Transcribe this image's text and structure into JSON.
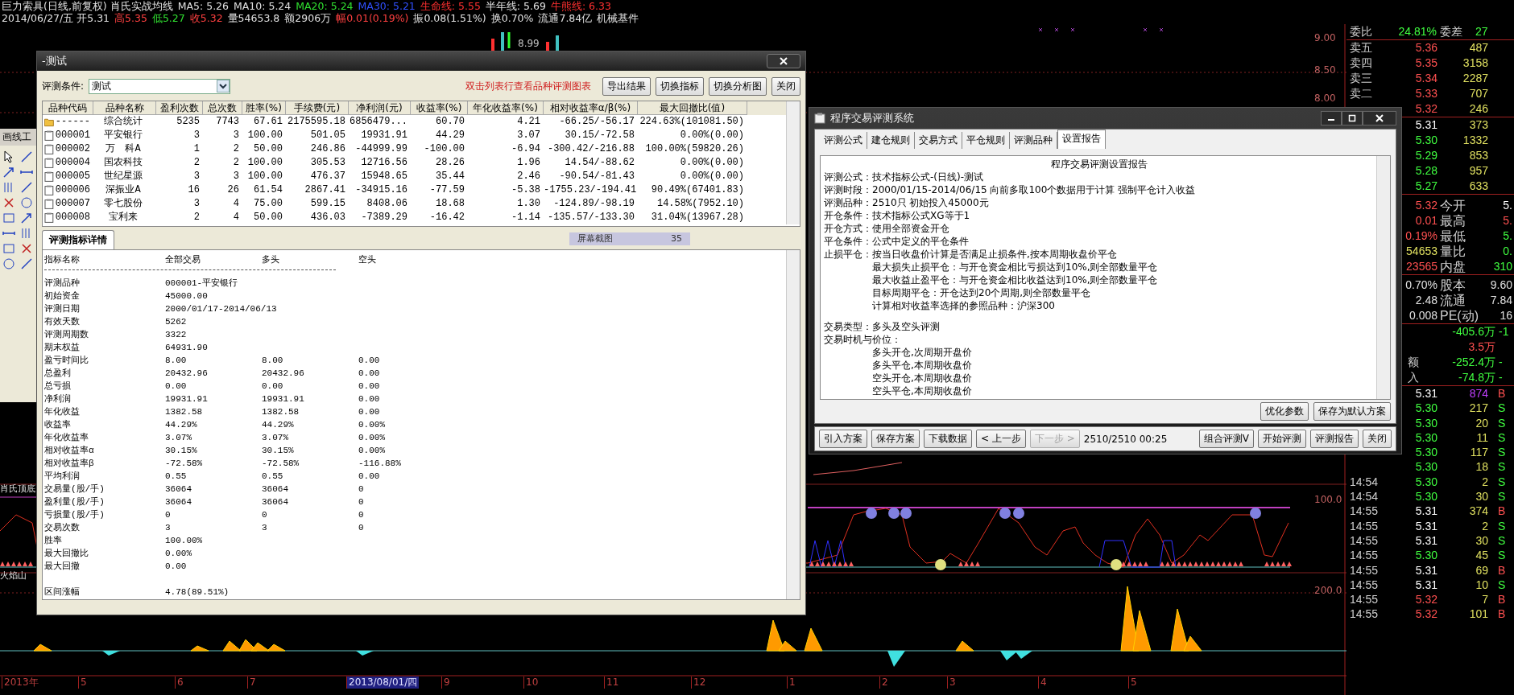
{
  "chart_header": {
    "lines": [
      [
        {
          "text": "巨力索具(日线,前复权) 肖氏实战均线",
          "color": "#e0e0e0"
        },
        {
          "text": "MA5: 5.26",
          "color": "#e0e0e0"
        },
        {
          "text": "MA10: 5.24",
          "color": "#e0e0e0"
        },
        {
          "text": "MA20: 5.24",
          "color": "#30e030"
        },
        {
          "text": "MA30: 5.21",
          "color": "#3050ff"
        },
        {
          "text": "生命线: 5.55",
          "color": "#ff3030"
        },
        {
          "text": "半年线: 5.69",
          "color": "#e0e0e0"
        },
        {
          "text": "牛熊线: 6.33",
          "color": "#ff3030"
        }
      ],
      [
        {
          "text": "2014/06/27/五 开5.31",
          "color": "#e0e0e0"
        },
        {
          "text": "高5.35",
          "color": "#ff4040"
        },
        {
          "text": "低5.27",
          "color": "#30e030"
        },
        {
          "text": "收5.32",
          "color": "#ff4040"
        },
        {
          "text": "量54653.8",
          "color": "#e0e0e0"
        },
        {
          "text": "额2906万",
          "color": "#e0e0e0"
        },
        {
          "text": "幅0.01(0.19%)",
          "color": "#ff4040"
        },
        {
          "text": "振0.08(1.51%)",
          "color": "#e0e0e0"
        },
        {
          "text": "换0.70%",
          "color": "#e0e0e0"
        },
        {
          "text": "流通7.84亿",
          "color": "#e0e0e0"
        },
        {
          "text": "机械基件",
          "color": "#e0e0e0"
        }
      ]
    ]
  },
  "chart": {
    "price_mark": "8.99",
    "price_axis": [
      "9.00",
      "8.50",
      "8.00"
    ],
    "indicator_axis": [
      "100.0",
      "200.0"
    ],
    "indicator_names": [
      "肖氏顶底",
      "火焰山"
    ],
    "time_axis": [
      {
        "label": "2013年",
        "selected": false
      },
      {
        "label": "5",
        "selected": false
      },
      {
        "label": "6",
        "selected": false
      },
      {
        "label": "7",
        "selected": false
      },
      {
        "label": "2013/08/01/四",
        "selected": true
      },
      {
        "label": "9",
        "selected": false
      },
      {
        "label": "10",
        "selected": false
      },
      {
        "label": "11",
        "selected": false
      },
      {
        "label": "12",
        "selected": false
      },
      {
        "label": "1",
        "selected": false
      },
      {
        "label": "2",
        "selected": false
      },
      {
        "label": "3",
        "selected": false
      },
      {
        "label": "4",
        "selected": false
      },
      {
        "label": "5",
        "selected": false
      }
    ]
  },
  "drawing_toolbar": {
    "title": "画线工"
  },
  "quote_panel": {
    "ratio": {
      "label": "委比",
      "value": "24.81%",
      "label2": "委差",
      "value2": "27"
    },
    "asks": [
      {
        "label": "卖五",
        "price": "5.36",
        "volume": "487",
        "color": "#ff5050"
      },
      {
        "label": "卖四",
        "price": "5.35",
        "volume": "3158",
        "color": "#ff5050"
      },
      {
        "label": "卖三",
        "price": "5.34",
        "volume": "2287",
        "color": "#ff5050"
      },
      {
        "label": "卖二",
        "price": "5.33",
        "volume": "707",
        "color": "#ff5050"
      },
      {
        "price": "5.32",
        "volume": "246",
        "color": "#ff5050"
      }
    ],
    "bids": [
      {
        "price": "5.31",
        "volume": "373",
        "color": "#ffffff"
      },
      {
        "price": "5.30",
        "volume": "1332",
        "color": "#40ff40"
      },
      {
        "price": "5.29",
        "volume": "853",
        "color": "#40ff40"
      },
      {
        "price": "5.28",
        "volume": "957",
        "color": "#40ff40"
      },
      {
        "price": "5.27",
        "volume": "633",
        "color": "#40ff40"
      }
    ],
    "stats": [
      {
        "figure": "5.32",
        "label": "今开",
        "right": {
          "text": "5.",
          "color": "#ffffff"
        },
        "color": "#ff5050"
      },
      {
        "figure": "0.01",
        "label": "最高",
        "right": {
          "text": "5.",
          "color": "#ff5050"
        },
        "color": "#ff5050"
      },
      {
        "figure": "0.19%",
        "label": "最低",
        "right": {
          "text": "5.",
          "color": "#40ff40"
        },
        "color": "#ff5050"
      },
      {
        "figure": "54653",
        "label": "量比",
        "right": {
          "text": "0.",
          "color": "#40ff40"
        },
        "color": "#e0e060"
      },
      {
        "figure": "23565",
        "label": "内盘",
        "right": {
          "text": "310",
          "color": "#40ff40"
        },
        "color": "#ff5050"
      },
      {
        "figure": "0.70%",
        "label": "股本",
        "right": {
          "text": "9.60",
          "color": "#e0e0e0"
        },
        "color": "#e0e0e0"
      },
      {
        "figure": "2.48",
        "label": "流通",
        "right": {
          "text": "7.84",
          "color": "#e0e0e0"
        },
        "color": "#e0e0e0"
      },
      {
        "figure": "0.008",
        "label": "PE(动)",
        "right": {
          "text": "16",
          "color": "#e0e0e0"
        },
        "color": "#e0e0e0"
      }
    ],
    "flows": [
      {
        "value": "-405.6万",
        "value2": "-1",
        "color": "#40ff40"
      },
      {
        "value": "3.5万",
        "color": "#ff5050"
      },
      {
        "label": "额",
        "value": "-252.4万",
        "value2": "-",
        "color": "#40ff40"
      },
      {
        "label": "入",
        "value": "-74.8万",
        "value2": "-",
        "color": "#40ff40"
      }
    ],
    "ticks": [
      {
        "price": "5.31",
        "volume": "874",
        "side": "B",
        "color": "#ffffff",
        "large": true
      },
      {
        "price": "5.30",
        "volume": "217",
        "side": "S",
        "color": "#40ff40",
        "large": false
      },
      {
        "price": "5.30",
        "volume": "20",
        "side": "S",
        "color": "#40ff40",
        "large": false
      },
      {
        "price": "5.30",
        "volume": "11",
        "side": "S",
        "color": "#40ff40",
        "large": false
      },
      {
        "price": "5.30",
        "volume": "117",
        "side": "S",
        "color": "#40ff40",
        "large": false
      },
      {
        "price": "5.30",
        "volume": "18",
        "side": "S",
        "color": "#40ff40",
        "large": false
      },
      {
        "time": "14:54",
        "price": "5.30",
        "volume": "2",
        "side": "S",
        "color": "#40ff40",
        "large": false
      },
      {
        "time": "14:54",
        "price": "5.30",
        "volume": "30",
        "side": "S",
        "color": "#40ff40",
        "large": false
      },
      {
        "time": "14:55",
        "price": "5.31",
        "volume": "374",
        "side": "B",
        "color": "#ffffff",
        "large": false
      },
      {
        "time": "14:55",
        "price": "5.31",
        "volume": "2",
        "side": "S",
        "color": "#ffffff",
        "large": false
      },
      {
        "time": "14:55",
        "price": "5.31",
        "volume": "30",
        "side": "S",
        "color": "#ffffff",
        "large": false
      },
      {
        "time": "14:55",
        "price": "5.30",
        "volume": "45",
        "side": "S",
        "color": "#40ff40",
        "large": false
      },
      {
        "time": "14:55",
        "price": "5.31",
        "volume": "69",
        "side": "B",
        "color": "#ffffff",
        "large": false
      },
      {
        "time": "14:55",
        "price": "5.31",
        "volume": "10",
        "side": "S",
        "color": "#ffffff",
        "large": false
      },
      {
        "time": "14:55",
        "price": "5.32",
        "volume": "7",
        "side": "B",
        "color": "#ff5050",
        "large": false
      },
      {
        "time": "14:55",
        "price": "5.32",
        "volume": "101",
        "side": "B",
        "color": "#ff5050",
        "large": false
      }
    ]
  },
  "test_dialog": {
    "title": "-测试",
    "condition_label": "评测条件:",
    "condition_value": "测试",
    "hint": "双击列表行查看品种评测图表",
    "buttons": [
      "导出结果",
      "切换指标",
      "切换分析图",
      "关闭"
    ],
    "columns": [
      "品种代码",
      "品种名称",
      "盈利次数",
      "总次数",
      "胜率(%)",
      "手续费(元)",
      "净利润(元)",
      "收益率(%)",
      "年化收益率(%)",
      "相对收益率α/β(%)",
      "最大回撤比(值)"
    ],
    "rows": [
      {
        "kind": "summary",
        "cells": [
          "------",
          "综合统计",
          "5235",
          "7743",
          "67.61",
          "2175595.18",
          "6856479...",
          "60.70",
          "4.21",
          "-66.25/-56.17",
          "224.63%(101081.50)"
        ]
      },
      {
        "kind": "stock",
        "cells": [
          "000001",
          "平安银行",
          "3",
          "3",
          "100.00",
          "501.05",
          "19931.91",
          "44.29",
          "3.07",
          "30.15/-72.58",
          "0.00%(0.00)"
        ]
      },
      {
        "kind": "stock",
        "cells": [
          "000002",
          "万　科A",
          "1",
          "2",
          "50.00",
          "246.86",
          "-44999.99",
          "-100.00",
          "-6.94",
          "-300.42/-216.88",
          "100.00%(59820.26)"
        ]
      },
      {
        "kind": "stock",
        "cells": [
          "000004",
          "国农科技",
          "2",
          "2",
          "100.00",
          "305.53",
          "12716.56",
          "28.26",
          "1.96",
          "14.54/-88.62",
          "0.00%(0.00)"
        ]
      },
      {
        "kind": "stock",
        "cells": [
          "000005",
          "世纪星源",
          "3",
          "3",
          "100.00",
          "476.37",
          "15948.65",
          "35.44",
          "2.46",
          "-90.54/-81.43",
          "0.00%(0.00)"
        ]
      },
      {
        "kind": "stock",
        "cells": [
          "000006",
          "深振业A",
          "16",
          "26",
          "61.54",
          "2867.41",
          "-34915.16",
          "-77.59",
          "-5.38",
          "-1755.23/-194.41",
          "90.49%(67401.83)"
        ]
      },
      {
        "kind": "stock",
        "cells": [
          "000007",
          "零七股份",
          "3",
          "4",
          "75.00",
          "599.15",
          "8408.06",
          "18.68",
          "1.30",
          "-124.89/-98.19",
          "14.58%(7952.10)"
        ]
      },
      {
        "kind": "stock",
        "cells": [
          "000008",
          "宝利来",
          "2",
          "4",
          "50.00",
          "436.03",
          "-7389.29",
          "-16.42",
          "-1.14",
          "-135.57/-133.30",
          "31.04%(13967.28)"
        ]
      }
    ],
    "popup": {
      "label": "屏幕截图",
      "count": "35"
    },
    "detail_tab": {
      "label": "评测指标详情",
      "selected": true
    },
    "detail_columns": [
      "指标名称",
      "全部交易",
      "多头",
      "空头"
    ],
    "detail_sections": [
      [
        {
          "cells": [
            "评测品种",
            "000001-平安银行"
          ]
        },
        {
          "cells": [
            "初始资金",
            "45000.00"
          ]
        },
        {
          "cells": [
            "评测日期",
            "2000/01/17-2014/06/13"
          ]
        },
        {
          "cells": [
            "有效天数",
            "5262"
          ]
        },
        {
          "cells": [
            "评测周期数",
            "3322"
          ]
        },
        {
          "cells": [
            "期末权益",
            "64931.90"
          ]
        },
        {
          "cells": [
            "盈亏时间比",
            "8.00",
            "8.00",
            "0.00"
          ]
        },
        {
          "cells": [
            "总盈利",
            "20432.96",
            "20432.96",
            "0.00"
          ]
        },
        {
          "cells": [
            "总亏损",
            "0.00",
            "0.00",
            "0.00"
          ]
        },
        {
          "cells": [
            "净利润",
            "19931.91",
            "19931.91",
            "0.00"
          ]
        },
        {
          "cells": [
            "年化收益",
            "1382.58",
            "1382.58",
            "0.00"
          ]
        },
        {
          "cells": [
            "收益率",
            "44.29%",
            "44.29%",
            "0.00%"
          ]
        },
        {
          "cells": [
            "年化收益率",
            "3.07%",
            "3.07%",
            "0.00%"
          ]
        },
        {
          "cells": [
            "相对收益率α",
            "30.15%",
            "30.15%",
            "0.00%"
          ]
        },
        {
          "cells": [
            "相对收益率β",
            "-72.58%",
            "-72.58%",
            "-116.88%"
          ]
        },
        {
          "cells": [
            "平均利润",
            "0.55",
            "0.55",
            "0.00"
          ]
        },
        {
          "cells": [
            "交易量(股/手)",
            "36064",
            "36064",
            "0"
          ]
        },
        {
          "cells": [
            "盈利量(股/手)",
            "36064",
            "36064",
            "0"
          ]
        },
        {
          "cells": [
            "亏损量(股/手)",
            "0",
            "0",
            "0"
          ]
        },
        {
          "cells": [
            "交易次数",
            "3",
            "3",
            "0"
          ]
        },
        {
          "cells": [
            "胜率",
            "100.00%"
          ]
        },
        {
          "cells": [
            "最大回撤比",
            "0.00%"
          ]
        },
        {
          "cells": [
            "最大回撤",
            "0.00"
          ]
        }
      ],
      [
        {
          "cells": [
            "区间涨幅",
            "4.78(89.51%)"
          ]
        }
      ]
    ]
  },
  "system_dialog": {
    "title": "程序交易评测系统",
    "tabs": [
      {
        "label": "评测公式",
        "selected": false
      },
      {
        "label": "建仓规则",
        "selected": false
      },
      {
        "label": "交易方式",
        "selected": false
      },
      {
        "label": "平仓规则",
        "selected": false
      },
      {
        "label": "评测品种",
        "selected": false
      },
      {
        "label": "设置报告",
        "selected": true
      }
    ],
    "report_title": "程序交易评测设置报告",
    "report_sections": [
      [
        {
          "text": "评测公式：技术指标公式-(日线)-测试",
          "indented": false
        },
        {
          "text": "评测时段：2000/01/15-2014/06/15 向前多取100个数据用于计算 强制平仓计入收益",
          "indented": false
        },
        {
          "text": "评测品种：2510只 初始投入45000元",
          "indented": false
        },
        {
          "text": "开仓条件：技术指标公式XG等于1",
          "indented": false
        },
        {
          "text": "开仓方式：使用全部资金开仓",
          "indented": false
        },
        {
          "text": "平仓条件：公式中定义的平仓条件",
          "indented": false
        },
        {
          "text": "止损平仓：按当日收盘价计算是否满足止损条件,按本周期收盘价平仓",
          "indented": false
        },
        {
          "text": "最大损失止损平仓：与开仓资金相比亏损达到10%,则全部数量平仓",
          "indented": true
        },
        {
          "text": "最大收益止盈平仓：与开仓资金相比收益达到10%,则全部数量平仓",
          "indented": true
        },
        {
          "text": "目标周期平仓：开仓达到20个周期,则全部数量平仓",
          "indented": true
        },
        {
          "text": "计算相对收益率选择的参照品种：沪深300",
          "indented": true
        }
      ],
      [
        {
          "text": "交易类型：多头及空头评测",
          "indented": false
        },
        {
          "text": "交易时机与价位：",
          "indented": false
        },
        {
          "text": "多头开仓,次周期开盘价",
          "indented": true
        },
        {
          "text": "多头平仓,本周期收盘价",
          "indented": true
        },
        {
          "text": "空头开仓,本周期收盘价",
          "indented": true
        },
        {
          "text": "空头平仓,本周期收盘价",
          "indented": true
        }
      ]
    ],
    "side_buttons": [
      "优化参数",
      "保存为默认方案"
    ],
    "left_buttons": [
      {
        "label": "引入方案",
        "disabled": false
      },
      {
        "label": "保存方案",
        "disabled": false
      },
      {
        "label": "下载数据",
        "disabled": false
      },
      {
        "label": "< 上一步",
        "disabled": false
      },
      {
        "label": "下一步 >",
        "disabled": true
      }
    ],
    "progress": "2510/2510 00:25",
    "right_buttons": [
      {
        "label": "组合评测V",
        "disabled": false
      },
      {
        "label": "开始评测",
        "disabled": false
      },
      {
        "label": "评测报告",
        "disabled": false
      },
      {
        "label": "关闭",
        "disabled": false
      }
    ]
  }
}
